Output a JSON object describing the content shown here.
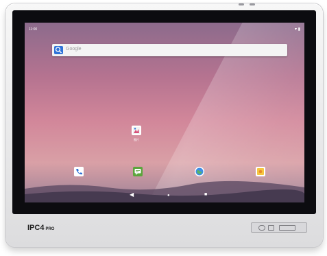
{
  "status_bar": {
    "time": "11:00",
    "icons": "▾ ▮"
  },
  "search": {
    "placeholder": "Google"
  },
  "apps": {
    "gallery_label": "图片"
  },
  "navbar": {
    "back": "◀",
    "home": "●",
    "recents": "■"
  },
  "device": {
    "brand": "IPC4",
    "model_suffix": "PRO"
  },
  "colors": {
    "accent_blue": "#2f73d8",
    "accent_green": "#5ba53c"
  }
}
